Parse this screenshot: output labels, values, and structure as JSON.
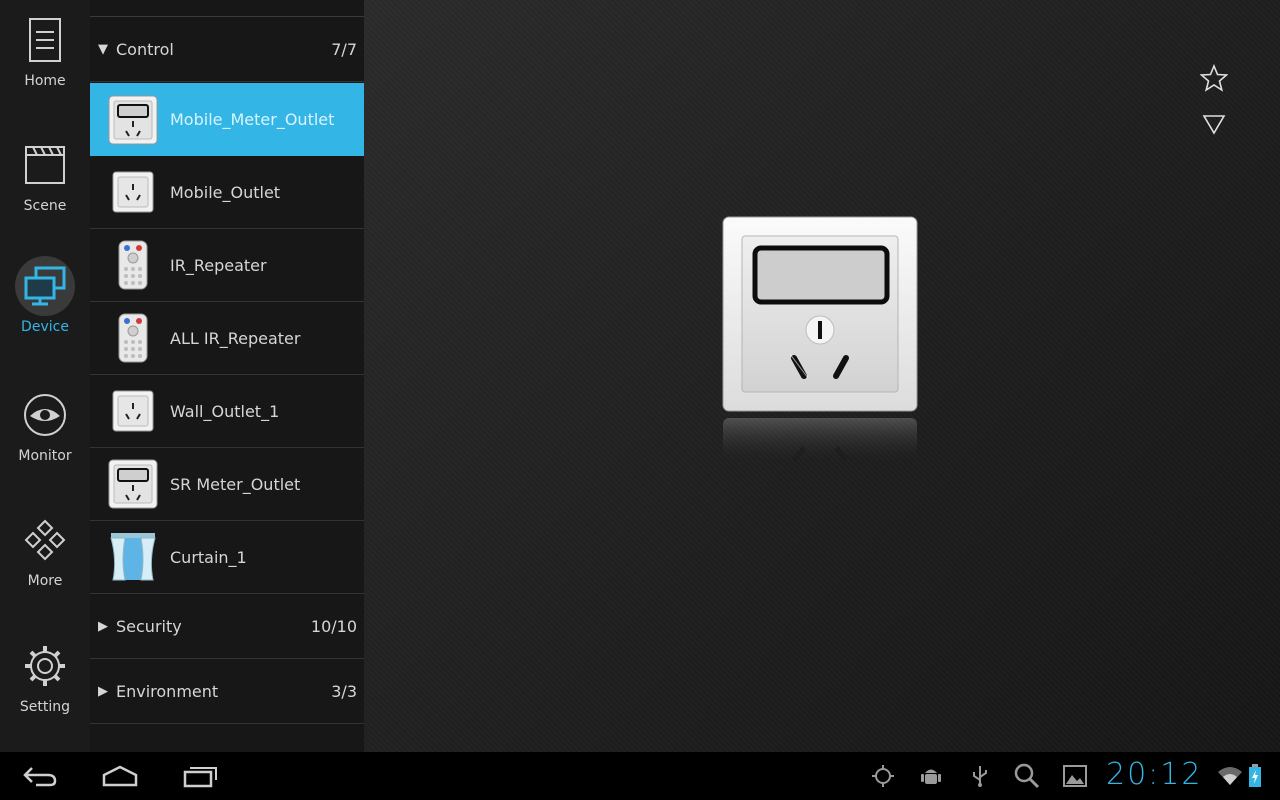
{
  "nav": {
    "home": "Home",
    "scene": "Scene",
    "device": "Device",
    "monitor": "Monitor",
    "more": "More",
    "setting": "Setting"
  },
  "device_list": {
    "groups": [
      {
        "name": "Control",
        "count": "7/7",
        "expanded": true
      },
      {
        "name": "Security",
        "count": "10/10",
        "expanded": false
      },
      {
        "name": "Environment",
        "count": "3/3",
        "expanded": false
      }
    ],
    "control_items": [
      {
        "label": "Mobile_Meter_Outlet",
        "icon": "meter-outlet-icon",
        "selected": true
      },
      {
        "label": "Mobile_Outlet",
        "icon": "outlet-icon"
      },
      {
        "label": "IR_Repeater",
        "icon": "remote-icon"
      },
      {
        "label": "ALL IR_Repeater",
        "icon": "remote-icon"
      },
      {
        "label": "Wall_Outlet_1",
        "icon": "outlet-icon"
      },
      {
        "label": "SR Meter_Outlet",
        "icon": "meter-outlet-icon"
      },
      {
        "label": "Curtain_1",
        "icon": "curtain-icon"
      }
    ]
  },
  "status": {
    "clock": "20:12"
  },
  "colors": {
    "accent": "#33b5e5",
    "panel": "#171717",
    "rail": "#1b1b1b"
  }
}
